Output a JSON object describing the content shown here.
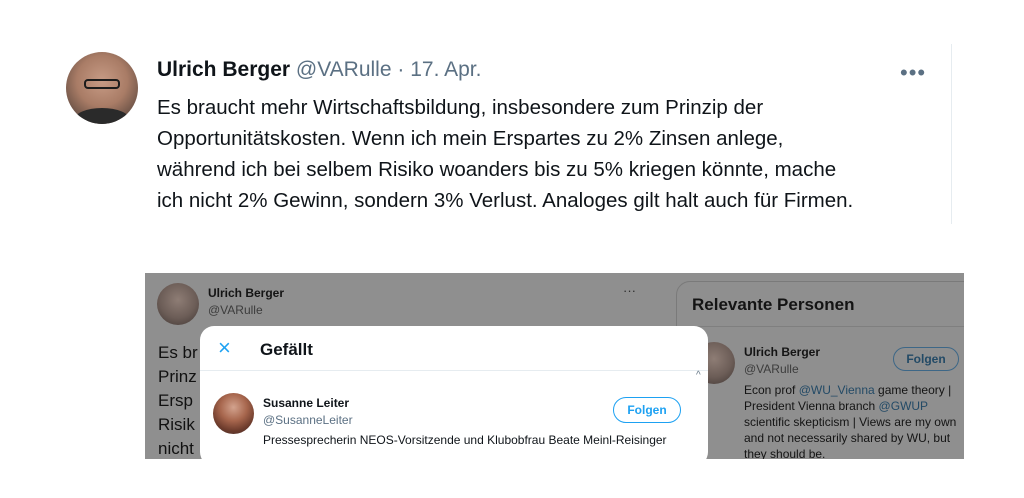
{
  "tweet": {
    "author_name": "Ulrich Berger",
    "handle": "@VARulle",
    "separator": "·",
    "date": "17. Apr.",
    "more_label": "•••",
    "text_lines": [
      "Es braucht mehr Wirtschaftsbildung, insbesondere zum Prinzip der",
      "Opportunitätskosten. Wenn ich mein Erspartes zu 2% Zinsen anlege,",
      "während ich bei selbem Risiko woanders bis zu 5% kriegen könnte, mache",
      "ich nicht 2% Gewinn, sondern 3% Verlust. Analoges gilt halt auch für Firmen."
    ]
  },
  "screenshot": {
    "background_tweet": {
      "author_name": "Ulrich Berger",
      "handle": "@VARulle",
      "more_label": "···",
      "text_fragments": [
        "Es br",
        "Prinz",
        "Ersp",
        "Risik",
        "nicht"
      ]
    },
    "relevant_people": {
      "title": "Relevante Personen",
      "person": {
        "name": "Ulrich Berger",
        "handle": "@VARulle",
        "follow_label": "Folgen",
        "bio_parts": {
          "p1": "Econ prof ",
          "m1": "@WU_Vienna",
          "p2": " game theory | President Vienna branch ",
          "m2": "@GWUP",
          "p3": " scientific skepticism | Views are my own and not necessarily shared by WU, but they should be."
        }
      }
    },
    "likes_modal": {
      "close_icon": "×",
      "title": "Gefällt",
      "scroll_icon": "^",
      "user": {
        "name": "Susanne Leiter",
        "handle": "@SusanneLeiter",
        "bio": "Pressesprecherin NEOS-Vorsitzende und Klubobfrau Beate Meinl-Reisinger",
        "follow_label": "Folgen"
      }
    }
  },
  "colors": {
    "accent": "#1da1f2",
    "text_primary": "#0f1419",
    "text_secondary": "#5b7083",
    "overlay_gray": "#8f8f8f"
  }
}
